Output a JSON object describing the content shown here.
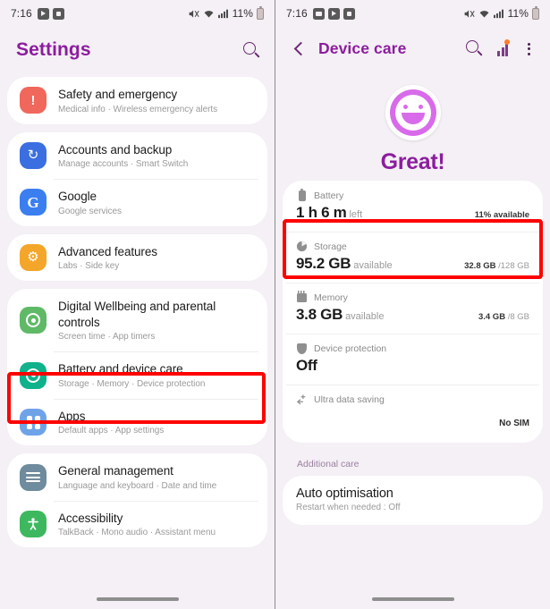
{
  "status_bar": {
    "time": "7:16",
    "left_icons_left": [
      "video-icon",
      "screenrecord-icon"
    ],
    "left_icons_right": [
      "gallery-icon",
      "video-icon",
      "screenrecord-icon"
    ],
    "battery_percent": "11%",
    "right_icons": [
      "mute-icon",
      "wifi-icon",
      "signal-icon"
    ]
  },
  "left_screen": {
    "header": {
      "title": "Settings",
      "search_icon": "search-icon"
    },
    "items": [
      {
        "title": "Safety and emergency",
        "subtitle": "Medical info  ·  Wireless emergency alerts",
        "icon": "alert-icon",
        "glyph": "!",
        "color": "#f0675b",
        "group": 0
      },
      {
        "title": "Accounts and backup",
        "subtitle": "Manage accounts  ·  Smart Switch",
        "icon": "sync-icon",
        "glyph": "↻",
        "color": "#3b6ee0",
        "group": 1
      },
      {
        "title": "Google",
        "subtitle": "Google services",
        "icon": "google-icon",
        "glyph": "G",
        "color": "#3b7ef0",
        "group": 1
      },
      {
        "title": "Advanced features",
        "subtitle": "Labs  ·  Side key",
        "icon": "gear-icon",
        "glyph": "⚙",
        "color": "#f4a62a",
        "group": 2
      },
      {
        "title": "Digital Wellbeing and parental controls",
        "subtitle": "Screen time  ·  App timers",
        "icon": "wellbeing-icon",
        "glyph": "",
        "color": "#5fb967",
        "group": 3
      },
      {
        "title": "Battery and device care",
        "subtitle": "Storage  ·  Memory  ·  Device protection",
        "icon": "device-care-icon",
        "glyph": "",
        "color": "#0fb28a",
        "group": 3,
        "highlighted": true
      },
      {
        "title": "Apps",
        "subtitle": "Default apps  ·  App settings",
        "icon": "apps-grid-icon",
        "glyph": "",
        "color": "#6fa3e8",
        "group": 3
      },
      {
        "title": "General management",
        "subtitle": "Language and keyboard  ·  Date and time",
        "icon": "sliders-icon",
        "glyph": "",
        "color": "#6f8b9e",
        "group": 4
      },
      {
        "title": "Accessibility",
        "subtitle": "TalkBack  ·  Mono audio  ·  Assistant menu",
        "icon": "accessibility-icon",
        "glyph": "Ɣ",
        "color": "#3eb85f",
        "group": 4
      }
    ]
  },
  "right_screen": {
    "header": {
      "title": "Device care",
      "back_icon": "back-arrow-icon",
      "search_icon": "search-icon",
      "chart_icon": "diagnostics-icon",
      "more_icon": "more-options-icon"
    },
    "score": {
      "face": "smiley-great-icon",
      "text": "Great!"
    },
    "cards": [
      {
        "name": "battery",
        "label": "Battery",
        "icon": "battery-icon",
        "value": "1 h 6 m",
        "unit": "left",
        "meter_percent": 11,
        "meter_color": "#e8414d",
        "caption_bold": "11% available",
        "caption_rest": "",
        "highlighted": true
      },
      {
        "name": "storage",
        "label": "Storage",
        "icon": "storage-icon",
        "value": "95.2 GB",
        "unit": "available",
        "meter_percent": 26,
        "meter_color": "#3ed6c0",
        "caption_bold": "32.8 GB",
        "caption_rest": " /128 GB"
      },
      {
        "name": "memory",
        "label": "Memory",
        "icon": "memory-icon",
        "value": "3.8 GB",
        "unit": "available",
        "meter_percent": 43,
        "meter_color": "#3b82e8",
        "caption_bold": "3.4 GB",
        "caption_rest": " /8 GB"
      },
      {
        "name": "device-protection",
        "label": "Device protection",
        "icon": "shield-icon",
        "value": "Off",
        "unit": "",
        "meter_percent": 0,
        "meter_color": "#e7e7e7",
        "caption_bold": "",
        "caption_rest": ""
      },
      {
        "name": "ultra-data-saving",
        "label": "Ultra data saving",
        "icon": "data-saver-icon",
        "value": "",
        "unit": "",
        "meter_percent": 0,
        "meter_color": "#e7e7e7",
        "caption_sim": "No SIM"
      }
    ],
    "additional_care_label": "Additional care",
    "auto_optimisation": {
      "title": "Auto optimisation",
      "subtitle": "Restart when needed : Off"
    }
  },
  "colors": {
    "accent": "#8c1d9e",
    "highlight": "#ff0000",
    "bg": "#f4f0f5"
  }
}
